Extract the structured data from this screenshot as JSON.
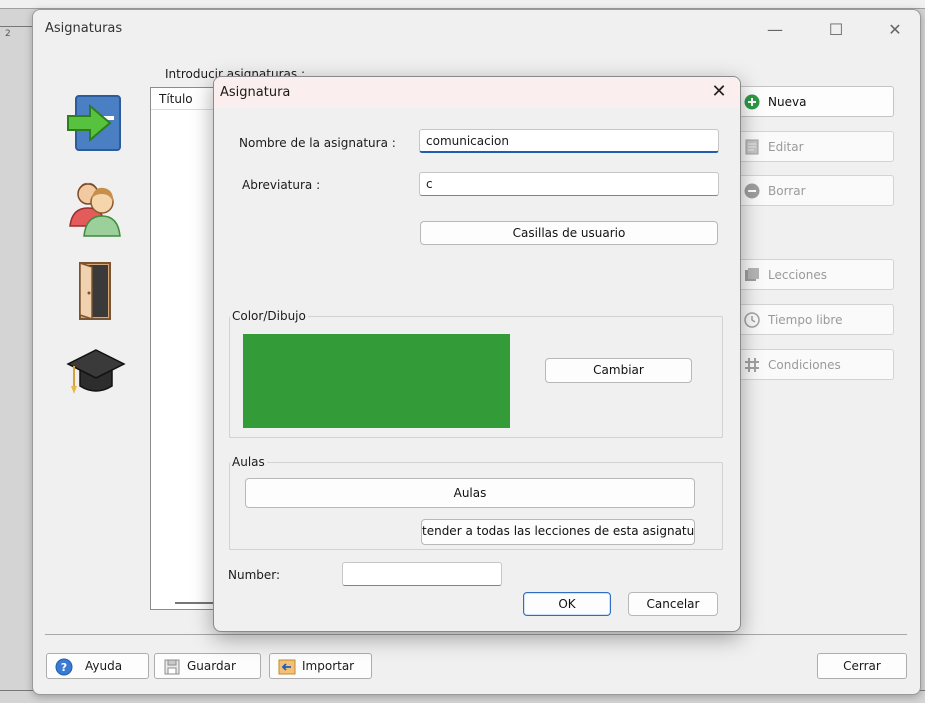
{
  "background_window": {
    "number_label": "2"
  },
  "main_window": {
    "title": "Asignaturas",
    "controls": {
      "minimize": "—",
      "maximize": "☐",
      "close": "✕"
    },
    "intro_label": "Introducir asignaturas :",
    "list_column_title": "Título",
    "right_buttons": [
      {
        "label": "Nueva",
        "icon": "plus-circle-icon",
        "enabled": true
      },
      {
        "label": "Editar",
        "icon": "edit-icon",
        "enabled": false
      },
      {
        "label": "Borrar",
        "icon": "minus-circle-icon",
        "enabled": false
      },
      {
        "label": "Lecciones",
        "icon": "lessons-icon",
        "enabled": false
      },
      {
        "label": "Tiempo libre",
        "icon": "clock-icon",
        "enabled": false
      },
      {
        "label": "Condiciones",
        "icon": "hash-icon",
        "enabled": false
      }
    ],
    "bottom_buttons": {
      "help": "Ayuda",
      "save": "Guardar",
      "import": "Importar",
      "close": "Cerrar"
    },
    "side_icons": [
      "arrow-right-icon",
      "teachers-icon",
      "door-icon",
      "graduation-cap-icon"
    ]
  },
  "dialog": {
    "title": "Asignatura",
    "close_glyph": "✕",
    "name_label": "Nombre de la asignatura :",
    "name_value": "comunicacion",
    "abbrev_label": "Abreviatura :",
    "abbrev_value": "c",
    "user_fields_button": "Casillas de usuario",
    "color_group_label": "Color/Dibujo",
    "color_value": "#339b37",
    "change_button": "Cambiar",
    "rooms_group_label": "Aulas",
    "rooms_button": "Aulas",
    "extend_button": "tender a todas las lecciones de esta asignatu",
    "number_label": "Number:",
    "number_value": "",
    "ok_button": "OK",
    "cancel_button": "Cancelar"
  },
  "colors": {
    "accent": "#1f5fae",
    "dialog_title_bg": "#fbeeee",
    "nueva_icon": "#2e9a46"
  }
}
